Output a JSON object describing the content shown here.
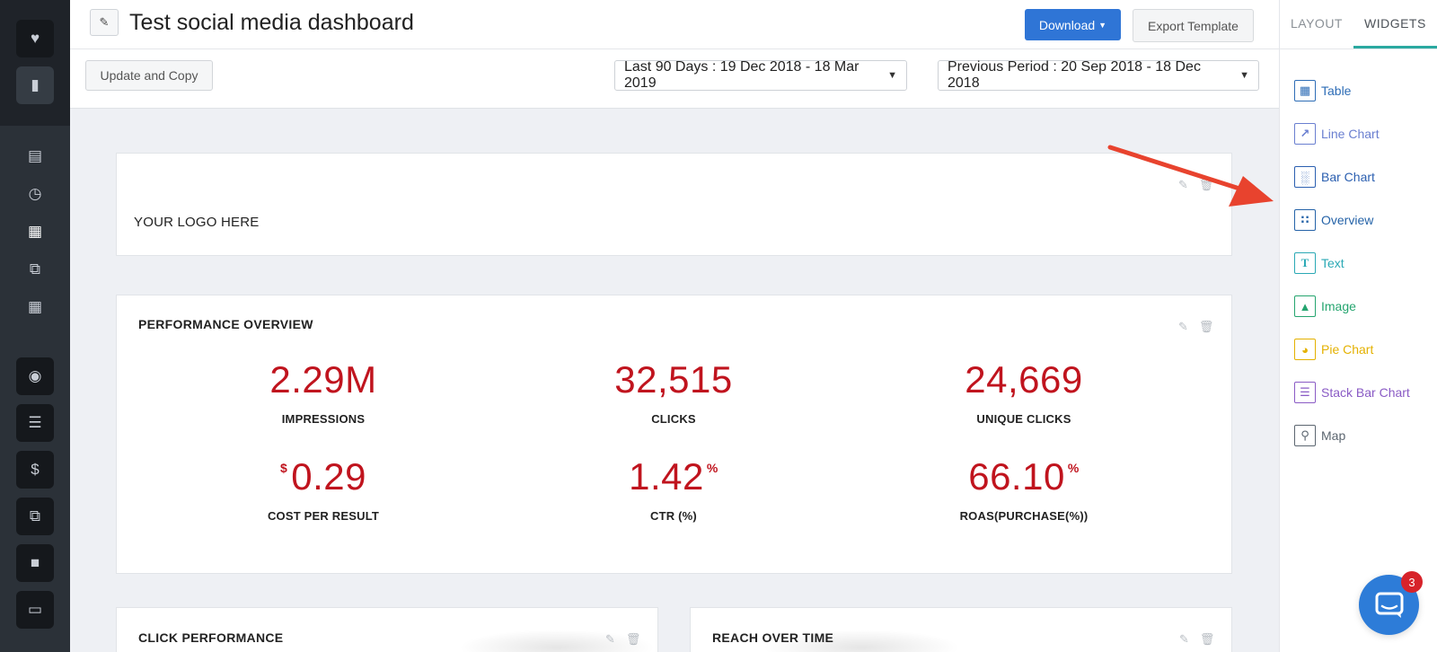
{
  "header": {
    "title": "Test social media dashboard",
    "download_label": "Download",
    "export_label": "Export Template"
  },
  "subbar": {
    "update_copy_label": "Update and Copy",
    "date_range": "Last 90 Days : 19 Dec 2018 - 18 Mar 2019",
    "compare_range": "Previous Period : 20 Sep 2018 - 18 Dec 2018"
  },
  "logo_card": {
    "text": "YOUR LOGO HERE"
  },
  "performance": {
    "heading": "PERFORMANCE OVERVIEW",
    "metrics": [
      {
        "value": "2.29M",
        "label": "IMPRESSIONS"
      },
      {
        "value": "32,515",
        "label": "CLICKS"
      },
      {
        "value": "24,669",
        "label": "UNIQUE CLICKS"
      },
      {
        "prefix": "$",
        "value": "0.29",
        "label": "COST PER RESULT"
      },
      {
        "value": "1.42",
        "suffix": "%",
        "label": "CTR (%)"
      },
      {
        "value": "66.10",
        "suffix": "%",
        "label": "ROAS(PURCHASE(%))"
      }
    ]
  },
  "click_perf": {
    "heading": "CLICK PERFORMANCE"
  },
  "reach": {
    "heading": "REACH OVER TIME"
  },
  "right_panel": {
    "tabs": [
      "LAYOUT",
      "WIDGETS"
    ],
    "active_tab": "WIDGETS",
    "widgets": [
      {
        "label": "Table",
        "icon": "table-icon",
        "color": "#2e6db6"
      },
      {
        "label": "Line Chart",
        "icon": "line-chart-icon",
        "color": "#6a7fd0"
      },
      {
        "label": "Bar Chart",
        "icon": "bar-chart-icon",
        "color": "#2b5fb0"
      },
      {
        "label": "Overview",
        "icon": "overview-icon",
        "color": "#2563a8"
      },
      {
        "label": "Text",
        "icon": "text-icon",
        "color": "#2aa9b5"
      },
      {
        "label": "Image",
        "icon": "image-icon",
        "color": "#25a56f"
      },
      {
        "label": "Pie Chart",
        "icon": "pie-chart-icon",
        "color": "#e4b100"
      },
      {
        "label": "Stack Bar Chart",
        "icon": "stack-bar-chart-icon",
        "color": "#8a5bc5"
      },
      {
        "label": "Map",
        "icon": "map-icon",
        "color": "#5c6670"
      }
    ]
  },
  "chat": {
    "badge_count": "3"
  },
  "colors": {
    "accent": "#2f75d6",
    "metric": "#c0141e",
    "teal": "#2aa9a0",
    "arrow": "#e8432e"
  }
}
